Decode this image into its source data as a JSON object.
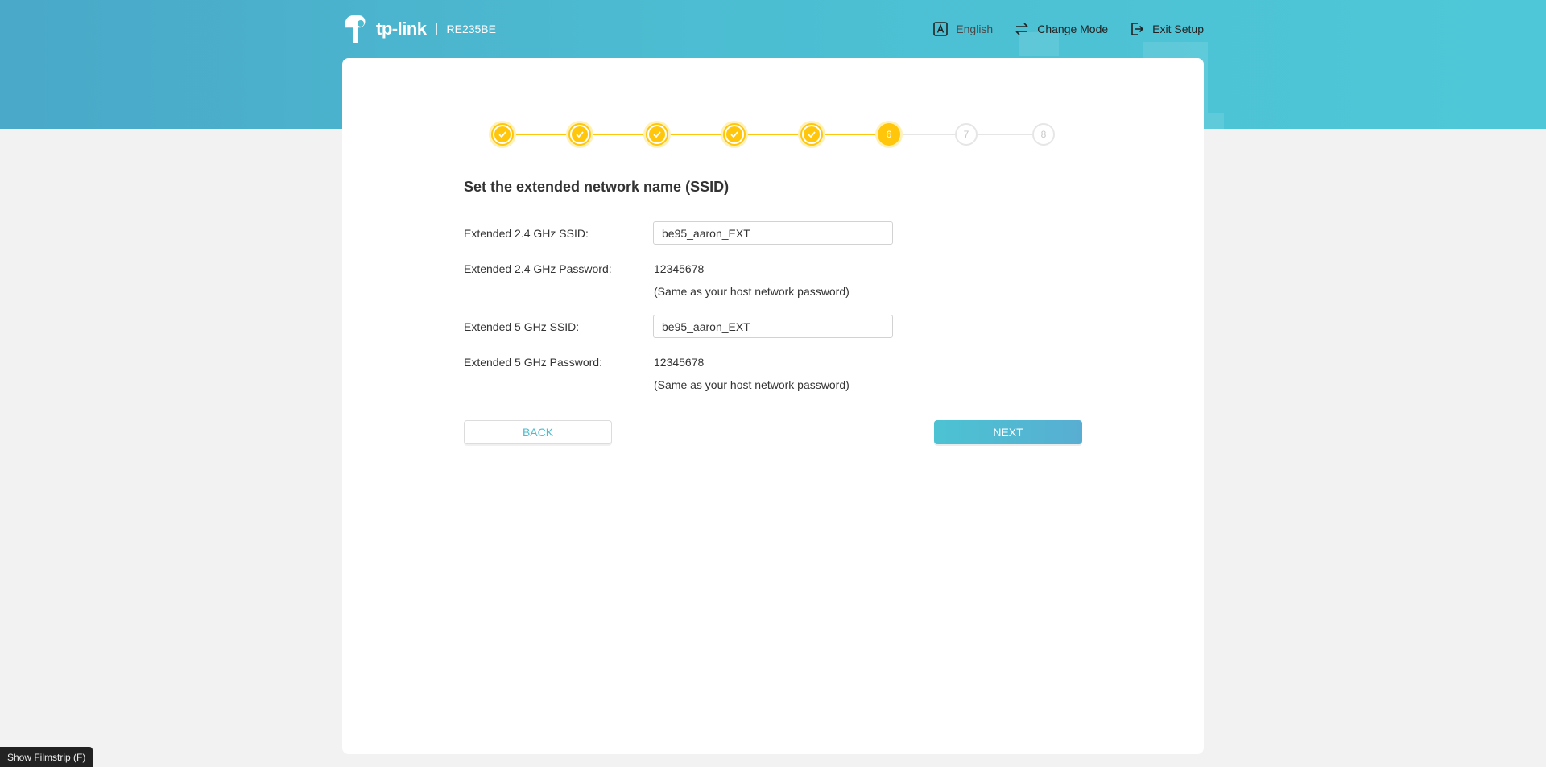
{
  "header": {
    "brand": "tp-link",
    "model": "RE235BE",
    "nav": [
      {
        "label": "English",
        "icon": "language-icon"
      },
      {
        "label": "Change Mode",
        "icon": "swap-icon"
      },
      {
        "label": "Exit Setup",
        "icon": "exit-icon"
      }
    ]
  },
  "stepper": {
    "steps": [
      {
        "state": "done",
        "label": ""
      },
      {
        "state": "done",
        "label": ""
      },
      {
        "state": "done",
        "label": ""
      },
      {
        "state": "done",
        "label": ""
      },
      {
        "state": "done",
        "label": ""
      },
      {
        "state": "current",
        "label": "6"
      },
      {
        "state": "todo",
        "label": "7"
      },
      {
        "state": "todo",
        "label": "8"
      }
    ],
    "active_color": "#ffc60b",
    "inactive_color": "#e6e6e6"
  },
  "form": {
    "title": "Set the extended network name (SSID)",
    "ssid24_label": "Extended 2.4 GHz SSID:",
    "ssid24_value": "be95_aaron_EXT",
    "pwd24_label": "Extended 2.4 GHz Password:",
    "pwd24_value": "12345678",
    "pwd24_note": "(Same as your host network password)",
    "ssid5_label": "Extended 5 GHz SSID:",
    "ssid5_value": "be95_aaron_EXT",
    "pwd5_label": "Extended 5 GHz Password:",
    "pwd5_value": "12345678",
    "pwd5_note": "(Same as your host network password)"
  },
  "buttons": {
    "back": "BACK",
    "next": "NEXT"
  },
  "filmstrip": {
    "label": "Show Filmstrip (F)"
  },
  "colors": {
    "accent": "#4bbdd0",
    "step": "#ffc60b"
  }
}
